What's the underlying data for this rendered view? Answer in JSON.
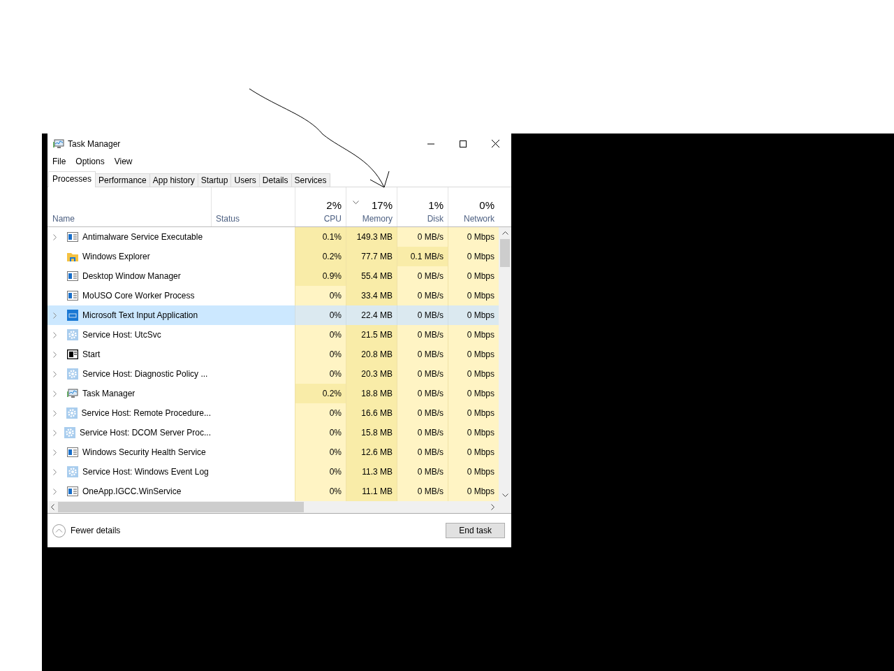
{
  "window": {
    "title": "Task Manager"
  },
  "menu": [
    "File",
    "Options",
    "View"
  ],
  "tabs": [
    {
      "label": "Processes",
      "selected": true
    },
    {
      "label": "Performance",
      "selected": false
    },
    {
      "label": "App history",
      "selected": false
    },
    {
      "label": "Startup",
      "selected": false
    },
    {
      "label": "Users",
      "selected": false
    },
    {
      "label": "Details",
      "selected": false
    },
    {
      "label": "Services",
      "selected": false
    }
  ],
  "columns": [
    {
      "label": "Name"
    },
    {
      "label": "Status"
    },
    {
      "percent": "2%",
      "label": "CPU",
      "sorted": false
    },
    {
      "percent": "17%",
      "label": "Memory",
      "sorted": true
    },
    {
      "percent": "1%",
      "label": "Disk",
      "sorted": false
    },
    {
      "percent": "0%",
      "label": "Network",
      "sorted": false
    }
  ],
  "rows": [
    {
      "kind": "app",
      "name": "Antimalware Service Executable",
      "expandable": true,
      "selected": false,
      "cells": [
        {
          "text": "0.1%",
          "hot": true
        },
        {
          "text": "149.3 MB",
          "hot": true
        },
        {
          "text": "0 MB/s",
          "hot": false
        },
        {
          "text": "0 Mbps",
          "hot": false
        }
      ]
    },
    {
      "kind": "folder",
      "name": "Windows Explorer",
      "expandable": false,
      "selected": false,
      "cells": [
        {
          "text": "0.2%",
          "hot": true
        },
        {
          "text": "77.7 MB",
          "hot": true
        },
        {
          "text": "0.1 MB/s",
          "hot": true
        },
        {
          "text": "0 Mbps",
          "hot": false
        }
      ]
    },
    {
      "kind": "app",
      "name": "Desktop Window Manager",
      "expandable": false,
      "selected": false,
      "cells": [
        {
          "text": "0.9%",
          "hot": true
        },
        {
          "text": "55.4 MB",
          "hot": true
        },
        {
          "text": "0 MB/s",
          "hot": false
        },
        {
          "text": "0 Mbps",
          "hot": false
        }
      ]
    },
    {
      "kind": "app",
      "name": "MoUSO Core Worker Process",
      "expandable": false,
      "selected": false,
      "cells": [
        {
          "text": "0%",
          "hot": false
        },
        {
          "text": "33.4 MB",
          "hot": true
        },
        {
          "text": "0 MB/s",
          "hot": false
        },
        {
          "text": "0 Mbps",
          "hot": false
        }
      ]
    },
    {
      "kind": "keyboard",
      "name": "Microsoft Text Input Application",
      "expandable": true,
      "selected": true,
      "cells": [
        {
          "text": "0%"
        },
        {
          "text": "22.4 MB"
        },
        {
          "text": "0 MB/s"
        },
        {
          "text": "0 Mbps"
        }
      ]
    },
    {
      "kind": "gear",
      "name": "Service Host: UtcSvc",
      "expandable": true,
      "selected": false,
      "cells": [
        {
          "text": "0%",
          "hot": false
        },
        {
          "text": "21.5 MB",
          "hot": true
        },
        {
          "text": "0 MB/s",
          "hot": false
        },
        {
          "text": "0 Mbps",
          "hot": false
        }
      ]
    },
    {
      "kind": "start",
      "name": "Start",
      "expandable": true,
      "selected": false,
      "cells": [
        {
          "text": "0%",
          "hot": false
        },
        {
          "text": "20.8 MB",
          "hot": true
        },
        {
          "text": "0 MB/s",
          "hot": false
        },
        {
          "text": "0 Mbps",
          "hot": false
        }
      ]
    },
    {
      "kind": "gear",
      "name": "Service Host: Diagnostic Policy ...",
      "expandable": true,
      "selected": false,
      "cells": [
        {
          "text": "0%",
          "hot": false
        },
        {
          "text": "20.3 MB",
          "hot": true
        },
        {
          "text": "0 MB/s",
          "hot": false
        },
        {
          "text": "0 Mbps",
          "hot": false
        }
      ]
    },
    {
      "kind": "monitor",
      "name": "Task Manager",
      "expandable": true,
      "selected": false,
      "cells": [
        {
          "text": "0.2%",
          "hot": true
        },
        {
          "text": "18.8 MB",
          "hot": true
        },
        {
          "text": "0 MB/s",
          "hot": false
        },
        {
          "text": "0 Mbps",
          "hot": false
        }
      ]
    },
    {
      "kind": "gear",
      "name": "Service Host: Remote Procedure...",
      "expandable": true,
      "selected": false,
      "cells": [
        {
          "text": "0%",
          "hot": false
        },
        {
          "text": "16.6 MB",
          "hot": true
        },
        {
          "text": "0 MB/s",
          "hot": false
        },
        {
          "text": "0 Mbps",
          "hot": false
        }
      ]
    },
    {
      "kind": "gear",
      "name": "Service Host: DCOM Server Proc...",
      "expandable": true,
      "selected": false,
      "cells": [
        {
          "text": "0%",
          "hot": false
        },
        {
          "text": "15.8 MB",
          "hot": true
        },
        {
          "text": "0 MB/s",
          "hot": false
        },
        {
          "text": "0 Mbps",
          "hot": false
        }
      ]
    },
    {
      "kind": "app",
      "name": "Windows Security Health Service",
      "expandable": true,
      "selected": false,
      "cells": [
        {
          "text": "0%",
          "hot": false
        },
        {
          "text": "12.6 MB",
          "hot": true
        },
        {
          "text": "0 MB/s",
          "hot": false
        },
        {
          "text": "0 Mbps",
          "hot": false
        }
      ]
    },
    {
      "kind": "gear",
      "name": "Service Host: Windows Event Log",
      "expandable": true,
      "selected": false,
      "cells": [
        {
          "text": "0%",
          "hot": false
        },
        {
          "text": "11.3 MB",
          "hot": true
        },
        {
          "text": "0 MB/s",
          "hot": false
        },
        {
          "text": "0 Mbps",
          "hot": false
        }
      ]
    },
    {
      "kind": "app",
      "name": "OneApp.IGCC.WinService",
      "expandable": true,
      "selected": false,
      "cells": [
        {
          "text": "0%",
          "hot": false
        },
        {
          "text": "11.1 MB",
          "hot": true
        },
        {
          "text": "0 MB/s",
          "hot": false
        },
        {
          "text": "0 Mbps",
          "hot": false
        }
      ]
    }
  ],
  "footer": {
    "toggle": "Fewer details",
    "button": "End task"
  }
}
